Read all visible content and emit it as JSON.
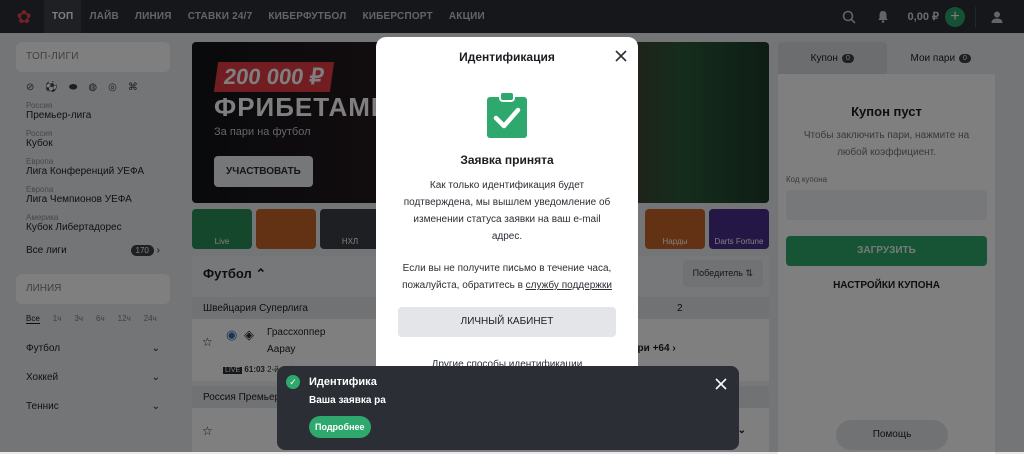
{
  "topbar": {
    "nav": [
      "ТОП",
      "ЛАЙВ",
      "ЛИНИЯ",
      "СТАВКИ 24/7",
      "КИБЕРФУТБОЛ",
      "КИБЕРСПОРТ",
      "АКЦИИ"
    ],
    "balance": "0,00 ₽",
    "plus": "+"
  },
  "left": {
    "top_leagues_title": "ТОП-ЛИГИ",
    "leagues": [
      {
        "country": "Россия",
        "name": "Премьер-лига"
      },
      {
        "country": "Россия",
        "name": "Кубок"
      },
      {
        "country": "Европа",
        "name": "Лига Конференций УЕФА"
      },
      {
        "country": "Европа",
        "name": "Лига Чемпионов УЕФА"
      },
      {
        "country": "Америка",
        "name": "Кубок Либертадорес"
      }
    ],
    "all_leagues": "Все лиги",
    "all_leagues_count": "170",
    "line_title": "ЛИНИЯ",
    "periods": [
      "Все",
      "1ч",
      "3ч",
      "6ч",
      "12ч",
      "24ч"
    ],
    "sports": [
      "Футбол",
      "Хоккей",
      "Теннис"
    ]
  },
  "banner": {
    "amount": "200 000 ₽",
    "title": "ФРИБЕТАМИ",
    "subtitle": "За пари на футбол",
    "button": "УЧАСТВОВАТЬ"
  },
  "tiles": [
    {
      "label": "Live",
      "color": "#2a8f5a"
    },
    {
      "label": "",
      "color": "#c7652a"
    },
    {
      "label": "НХЛ",
      "color": "#3b3f46"
    },
    {
      "label": "Нарды",
      "color": "#c7652a"
    },
    {
      "label": "Darts Fortune",
      "color": "#4a2f8a"
    }
  ],
  "section": {
    "title": "Футбол",
    "sort": "Победитель",
    "league1": "Швейцария Суперлига",
    "col2": "2",
    "team1": "Грассхоппер",
    "team2": "Аарау",
    "live_time": "61:03",
    "live_score": "2-й тайм (2:0:0:0)",
    "more": "ари +64",
    "league2": "Россия Премьер-лига",
    "more2": "4"
  },
  "coupon": {
    "tab1": "Купон",
    "tab1_count": "0",
    "tab2": "Мои пари",
    "tab2_count": "0",
    "empty_title": "Купон пуст",
    "empty_text": "Чтобы заключить пари, нажмите на любой коэффициент.",
    "code_label": "Код купона",
    "load": "ЗАГРУЗИТЬ",
    "settings": "НАСТРОЙКИ КУПОНА",
    "help": "Помощь"
  },
  "modal": {
    "title": "Идентификация",
    "heading": "Заявка принята",
    "text1": "Как только идентификация будет подтверждена, мы вышлем уведомление об изменении статуса заявки на ваш e-mail адрес.",
    "text2_prefix": "Если вы не получите письмо в течение часа, пожалуйста, обратитесь в ",
    "text2_link": "службу поддержки",
    "button": "ЛИЧНЫЙ КАБИНЕТ",
    "other_link": "Другие способы идентификации"
  },
  "toast": {
    "title": "Идентифика",
    "text": "Ваша заявка ра",
    "button": "Подробнее"
  }
}
